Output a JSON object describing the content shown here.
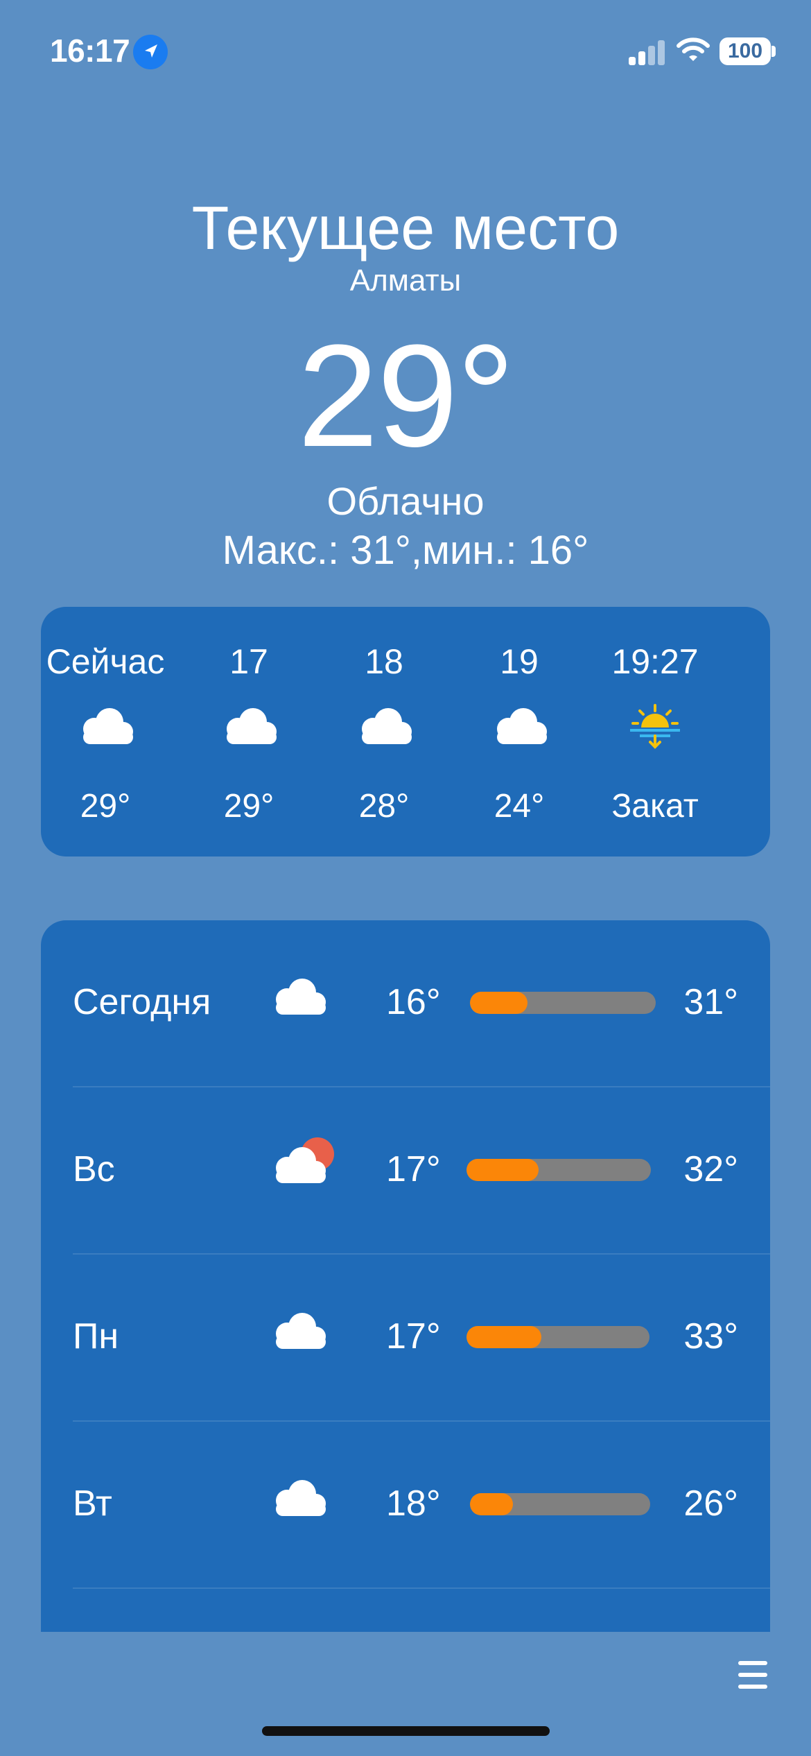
{
  "status_bar": {
    "time": "16:17",
    "battery": "100",
    "icons": [
      "location-arrow-icon",
      "signal-icon",
      "wifi-icon",
      "battery-icon"
    ]
  },
  "header": {
    "title": "Текущее место",
    "city": "Алматы",
    "temperature": "29°",
    "condition": "Облачно",
    "min_max": "Макс.: 31°,мин.: 16°"
  },
  "hourly": [
    {
      "label": "Сейчас",
      "icon": "cloud-icon",
      "temp": "29°"
    },
    {
      "label": "17",
      "icon": "cloud-icon",
      "temp": "29°"
    },
    {
      "label": "18",
      "icon": "cloud-icon",
      "temp": "28°"
    },
    {
      "label": "19",
      "icon": "cloud-icon",
      "temp": "24°"
    },
    {
      "label": "19:27",
      "icon": "sunset-icon",
      "temp": "Закат"
    }
  ],
  "daily": [
    {
      "day": "Сегодня",
      "icon": "cloud-icon",
      "min": "16°",
      "max": "31°",
      "range_start": 0.0,
      "range_end": 0.31
    },
    {
      "day": "Вс",
      "icon": "cloud-sun-icon",
      "min": "17°",
      "max": "32°",
      "range_start": 0.0,
      "range_end": 0.39
    },
    {
      "day": "Пн",
      "icon": "cloud-icon",
      "min": "17°",
      "max": "33°",
      "range_start": 0.0,
      "range_end": 0.41
    },
    {
      "day": "Вт",
      "icon": "cloud-icon",
      "min": "18°",
      "max": "26°",
      "range_start": 0.0,
      "range_end": 0.24
    }
  ],
  "colors": {
    "background": "#5b8fc4",
    "card": "#1f6bb8",
    "bar_fill": "#fb8608",
    "bar_track": "#808080"
  }
}
